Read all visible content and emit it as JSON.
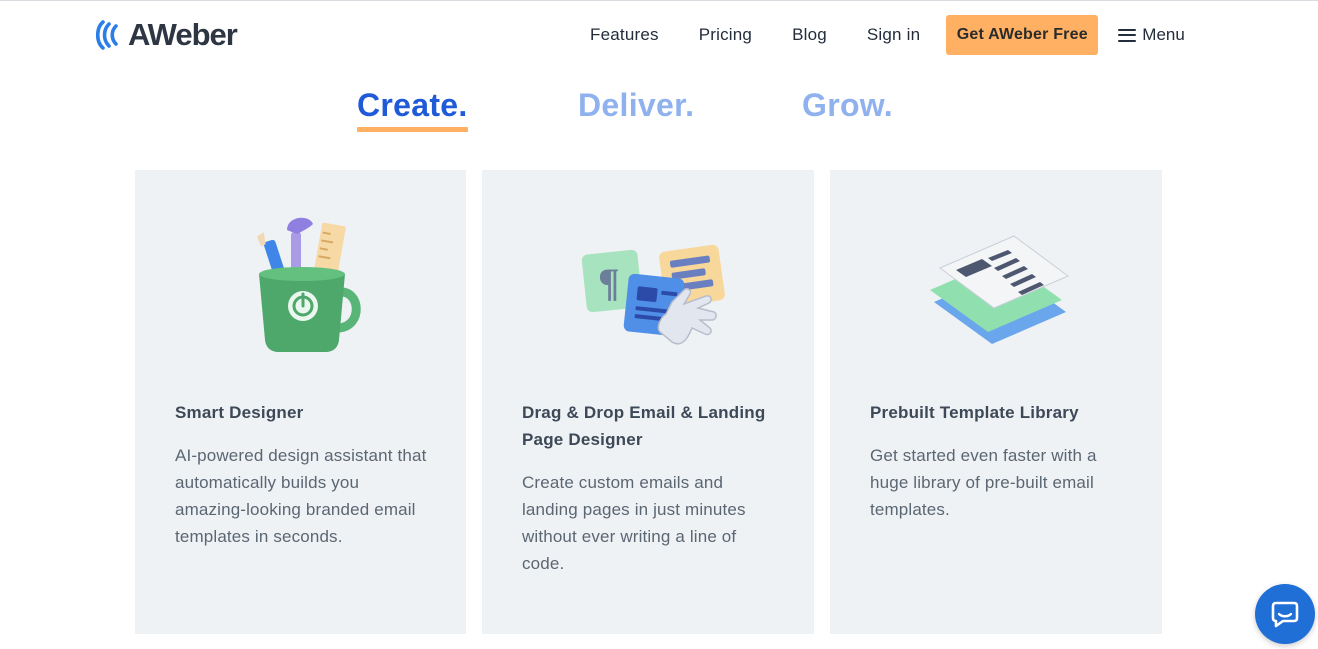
{
  "brand": {
    "name": "AWeber"
  },
  "nav": {
    "items": [
      "Features",
      "Pricing",
      "Blog",
      "Sign in"
    ],
    "cta_label": "Get AWeber Free",
    "menu_label": "Menu"
  },
  "tabs": {
    "items": [
      {
        "label": "Create.",
        "state": "active"
      },
      {
        "label": "Deliver.",
        "state": "inactive"
      },
      {
        "label": "Grow.",
        "state": "inactive"
      }
    ]
  },
  "cards": [
    {
      "icon": "mug-with-tools-icon",
      "title": "Smart Designer",
      "description": "AI-powered design assistant that automatically builds you amazing-looking branded email templates in seconds."
    },
    {
      "icon": "drag-drop-blocks-icon",
      "title": "Drag & Drop Email & Landing Page Designer",
      "description": "Create custom emails and landing pages in just minutes without ever writing a line of code."
    },
    {
      "icon": "template-stack-icon",
      "title": "Prebuilt Template Library",
      "description": "Get started even faster with a huge library of pre-built email templates."
    }
  ],
  "colors": {
    "brand_blue": "#1f5ad8",
    "tab_inactive": "#8fb1ee",
    "accent_orange": "#ffb062",
    "card_bg": "#eff2f5",
    "chat_blue": "#1f6fd6"
  },
  "chat_widget": {
    "icon": "chat-bubble-icon"
  }
}
